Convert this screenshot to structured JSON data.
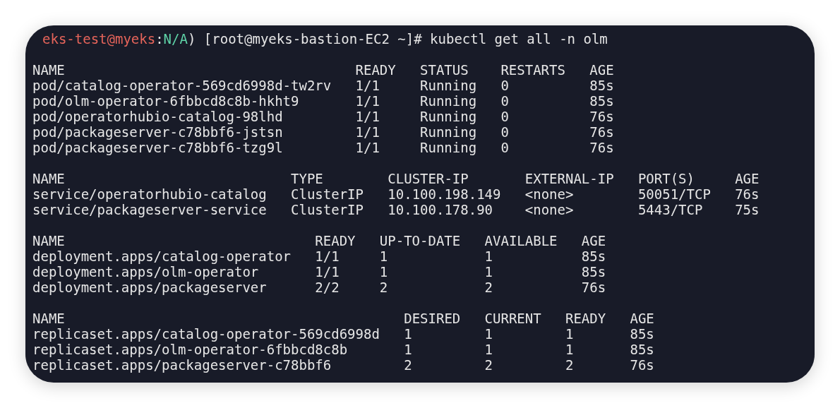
{
  "prompt": [
    {
      "text": "eks-test@myeks",
      "color": "#e5645a"
    },
    {
      "text": ":",
      "color": "#e6e6e6"
    },
    {
      "text": "N/A",
      "color": "#5fd4a8"
    },
    {
      "text": ") [root@myeks-bastion-EC2 ~]# kubectl get all -n olm",
      "color": "#e6e6e6"
    }
  ],
  "sections": [
    {
      "columns": [
        "NAME",
        "READY",
        "STATUS",
        "RESTARTS",
        "AGE"
      ],
      "rows": [
        [
          "pod/catalog-operator-569cd6998d-tw2rv",
          "1/1",
          "Running",
          "0",
          "85s"
        ],
        [
          "pod/olm-operator-6fbbcd8c8b-hkht9",
          "1/1",
          "Running",
          "0",
          "85s"
        ],
        [
          "pod/operatorhubio-catalog-98lhd",
          "1/1",
          "Running",
          "0",
          "76s"
        ],
        [
          "pod/packageserver-c78bbf6-jstsn",
          "1/1",
          "Running",
          "0",
          "76s"
        ],
        [
          "pod/packageserver-c78bbf6-tzg9l",
          "1/1",
          "Running",
          "0",
          "76s"
        ]
      ]
    },
    {
      "columns": [
        "NAME",
        "TYPE",
        "CLUSTER-IP",
        "EXTERNAL-IP",
        "PORT(S)",
        "AGE"
      ],
      "rows": [
        [
          "service/operatorhubio-catalog",
          "ClusterIP",
          "10.100.198.149",
          "<none>",
          "50051/TCP",
          "76s"
        ],
        [
          "service/packageserver-service",
          "ClusterIP",
          "10.100.178.90",
          "<none>",
          "5443/TCP",
          "75s"
        ]
      ]
    },
    {
      "columns": [
        "NAME",
        "READY",
        "UP-TO-DATE",
        "AVAILABLE",
        "AGE"
      ],
      "rows": [
        [
          "deployment.apps/catalog-operator",
          "1/1",
          "1",
          "1",
          "85s"
        ],
        [
          "deployment.apps/olm-operator",
          "1/1",
          "1",
          "1",
          "85s"
        ],
        [
          "deployment.apps/packageserver",
          "2/2",
          "2",
          "2",
          "76s"
        ]
      ]
    },
    {
      "columns": [
        "NAME",
        "DESIRED",
        "CURRENT",
        "READY",
        "AGE"
      ],
      "rows": [
        [
          "replicaset.apps/catalog-operator-569cd6998d",
          "1",
          "1",
          "1",
          "85s"
        ],
        [
          "replicaset.apps/olm-operator-6fbbcd8c8b",
          "1",
          "1",
          "1",
          "85s"
        ],
        [
          "replicaset.apps/packageserver-c78bbf6",
          "2",
          "2",
          "2",
          "76s"
        ]
      ]
    }
  ]
}
